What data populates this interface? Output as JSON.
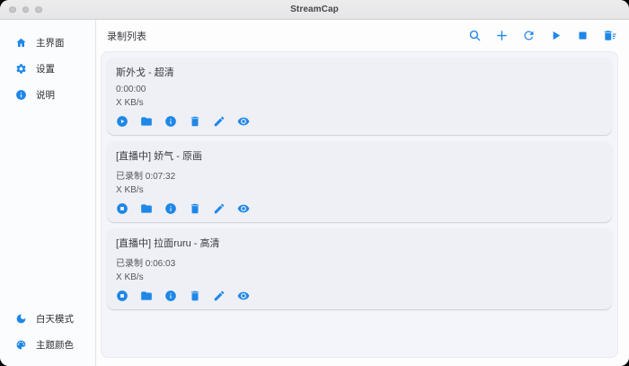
{
  "window": {
    "title": "StreamCap"
  },
  "colors": {
    "accent": "#1e87e8",
    "panel_bg": "#f4f5fa",
    "card_bg": "#eef0f6",
    "titlebar_bg": "#e9e9ea"
  },
  "sidebar": {
    "items": [
      {
        "label": "主界面",
        "icon": "home-icon"
      },
      {
        "label": "设置",
        "icon": "gear-icon"
      },
      {
        "label": "说明",
        "icon": "info-icon"
      }
    ],
    "footer_items": [
      {
        "label": "白天模式",
        "icon": "moon-icon"
      },
      {
        "label": "主题颜色",
        "icon": "palette-icon"
      }
    ]
  },
  "header": {
    "title": "录制列表",
    "toolbar_icons": [
      "search-icon",
      "plus-icon",
      "refresh-icon",
      "play-icon",
      "stop-icon",
      "batch-delete-icon"
    ]
  },
  "cards": [
    {
      "title": "斯外戈 - 超清",
      "duration": "0:00:00",
      "speed": "X KB/s",
      "state": "idle",
      "action_icons": [
        "play-circle-icon",
        "folder-icon",
        "info-circle-icon",
        "trash-icon",
        "pencil-icon",
        "eye-icon"
      ]
    },
    {
      "title": "[直播中] 娇气 - 原画",
      "duration": "已录制 0:07:32",
      "speed": "X KB/s",
      "state": "recording",
      "action_icons": [
        "stop-circle-icon",
        "folder-icon",
        "info-circle-icon",
        "trash-icon",
        "pencil-icon",
        "eye-icon"
      ]
    },
    {
      "title": "[直播中] 拉面ruru - 高清",
      "duration": "已录制 0:06:03",
      "speed": "X KB/s",
      "state": "recording",
      "action_icons": [
        "stop-circle-icon",
        "folder-icon",
        "info-circle-icon",
        "trash-icon",
        "pencil-icon",
        "eye-icon"
      ]
    }
  ]
}
